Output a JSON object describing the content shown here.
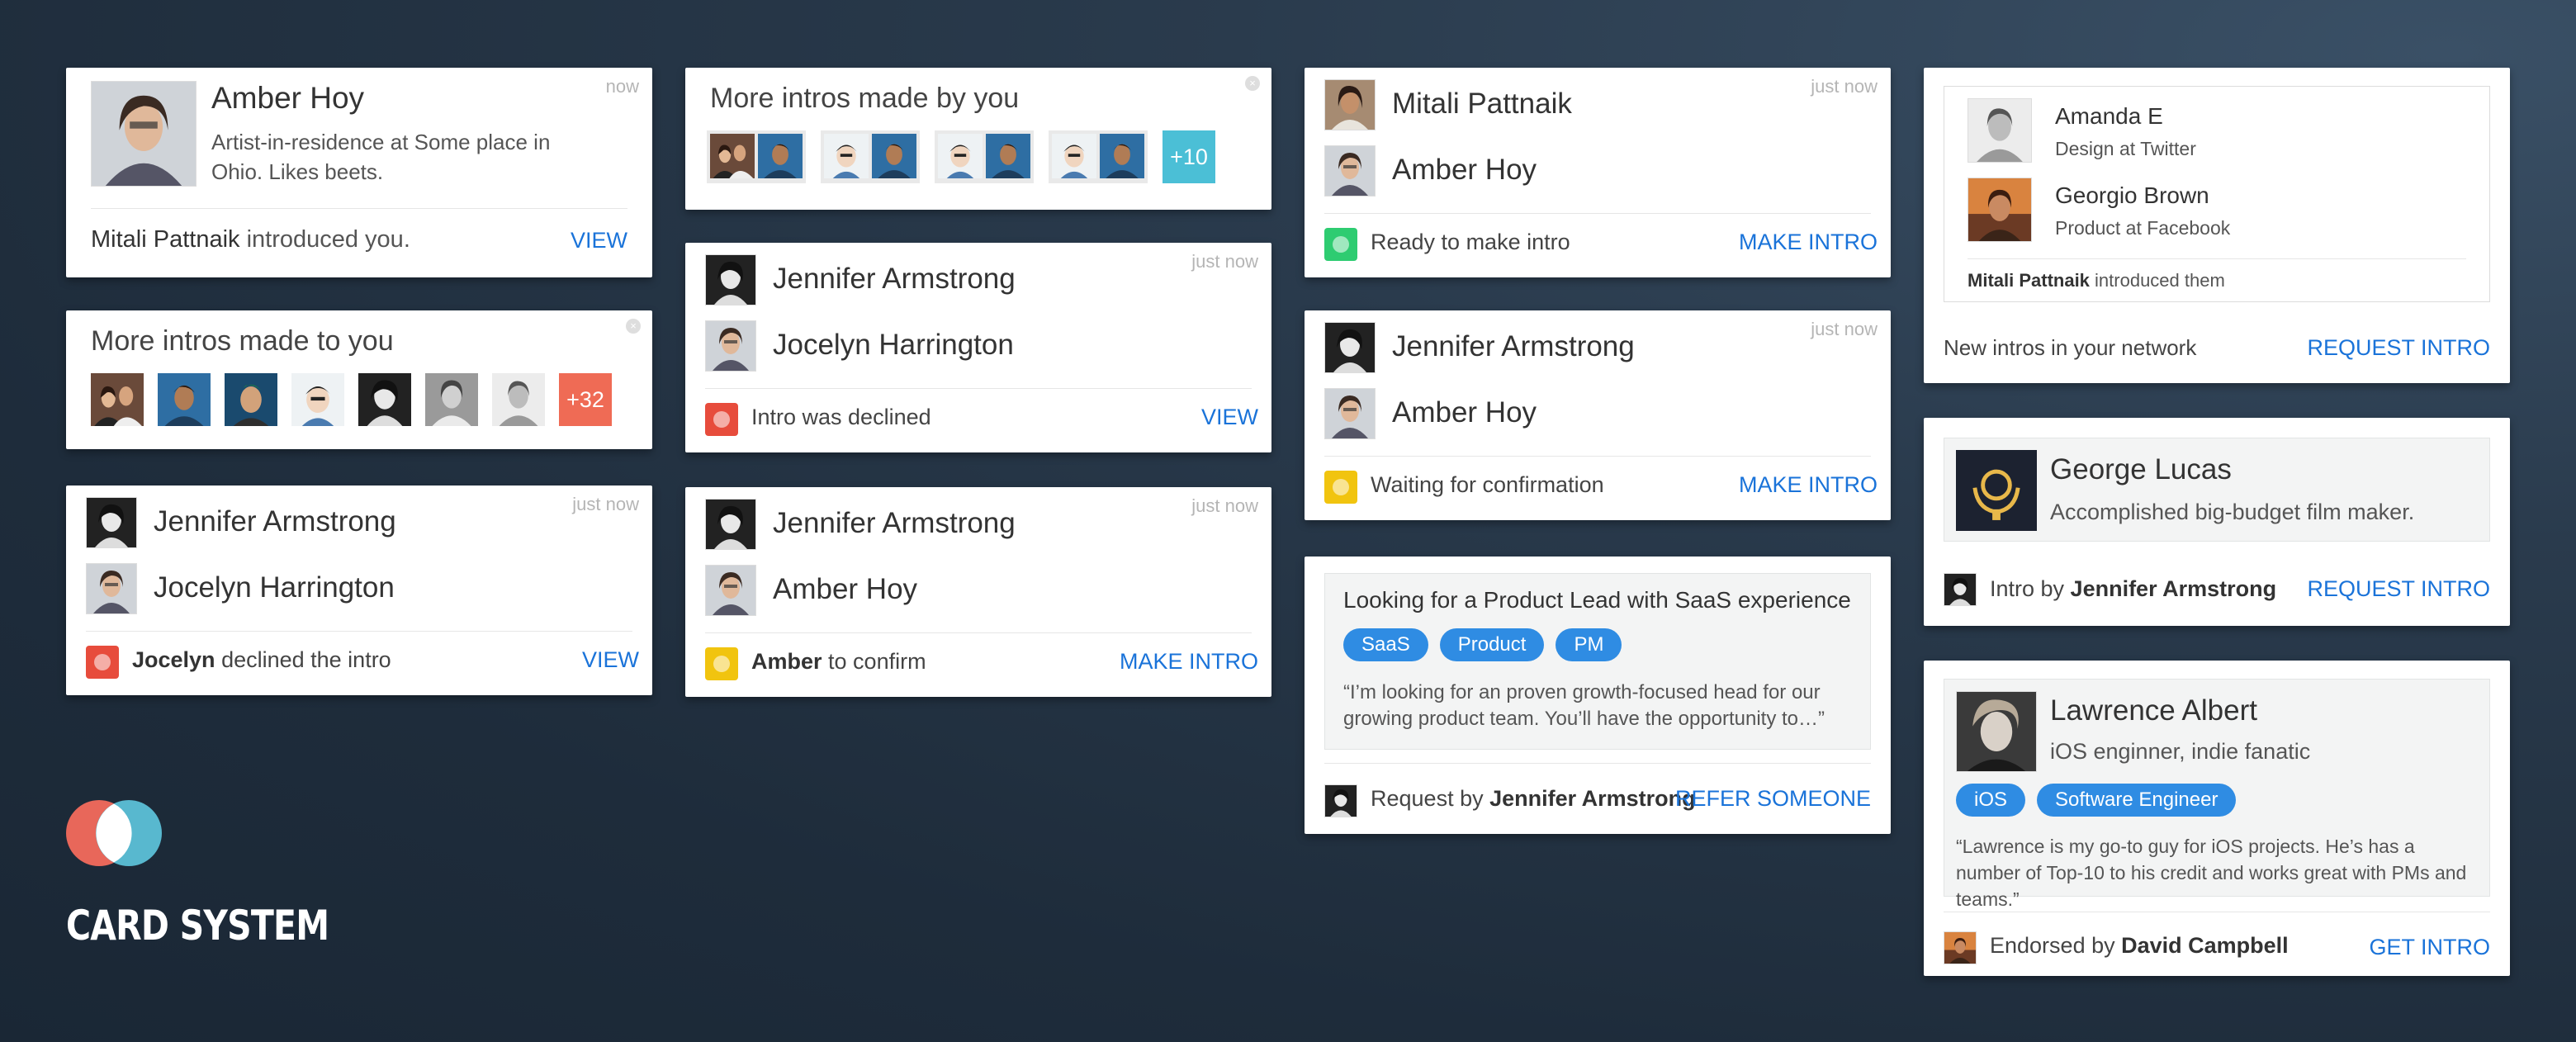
{
  "brand": {
    "title": "CARD SYSTEM",
    "colors": {
      "coral": "#e8675a",
      "teal": "#58b8cf"
    }
  },
  "colors": {
    "link": "#1a73d9",
    "green": "#2ecc71",
    "red": "#e74c3c",
    "yellow": "#f1c40f",
    "orange": "#ef6b55",
    "cyan": "#4bbfd6",
    "tag": "#2f8ce3"
  },
  "c1": {
    "time": "now",
    "name": "Amber Hoy",
    "bio": "Artist-in-residence at Some place in Ohio. Likes beets.",
    "intro_name": "Mitali Pattnaik",
    "intro_rest": " introduced you.",
    "action": "VIEW",
    "avatar_icon": "portrait-icon"
  },
  "c2": {
    "title": "More intros made to you",
    "close": "×",
    "more": "+32"
  },
  "c3": {
    "time": "just now",
    "p1": "Jennifer Armstrong",
    "p2": "Jocelyn Harrington",
    "who": "Jocelyn",
    "status_text": " declined the intro",
    "action": "VIEW"
  },
  "c4": {
    "title": "More intros made by you",
    "close": "×",
    "more": "+10"
  },
  "c5": {
    "time": "just now",
    "p1": "Jennifer Armstrong",
    "p2": "Jocelyn Harrington",
    "status": "Intro was declined",
    "action": "VIEW"
  },
  "c6": {
    "time": "just now",
    "p1": "Jennifer Armstrong",
    "p2": "Amber Hoy",
    "who": "Amber",
    "status_text": " to confirm",
    "action": "MAKE INTRO"
  },
  "c7": {
    "time": "just now",
    "p1": "Mitali Pattnaik",
    "p2": "Amber Hoy",
    "status": "Ready to make intro",
    "action": "MAKE INTRO"
  },
  "c8": {
    "time": "just now",
    "p1": "Jennifer Armstrong",
    "p2": "Amber Hoy",
    "status": "Waiting for confirmation",
    "action": "MAKE INTRO"
  },
  "c9": {
    "title": "Looking for a Product Lead with SaaS experience",
    "tags": [
      "SaaS",
      "Product",
      "PM"
    ],
    "quote": "“I’m looking for an proven growth-focused head for our growing product team. You’ll have the opportunity to…”",
    "by_label": "Request by ",
    "by_name": "Jennifer Armstrong",
    "action": "REFER SOMEONE"
  },
  "c10": {
    "p1": "Amanda E",
    "p1_role": "Design at Twitter",
    "p2": "Georgio Brown",
    "p2_role": "Product at Facebook",
    "intro_name": "Mitali Pattnaik",
    "intro_rest": " introduced them",
    "footer": "New intros in your network",
    "action": "REQUEST INTRO"
  },
  "c11": {
    "name": "George Lucas",
    "bio": "Accomplished big-budget film maker.",
    "by_label": "Intro by ",
    "by_name": "Jennifer Armstrong",
    "action": "REQUEST INTRO"
  },
  "c12": {
    "name": "Lawrence Albert",
    "bio": "iOS enginner, indie fanatic",
    "tags": [
      "iOS",
      "Software Engineer"
    ],
    "quote": "“Lawrence is my go-to guy for iOS projects. He’s has a number of Top-10 to his credit and works great with PMs and teams.”",
    "by_label": "Endorsed by ",
    "by_name": "David Campbell",
    "action": "GET INTRO"
  }
}
